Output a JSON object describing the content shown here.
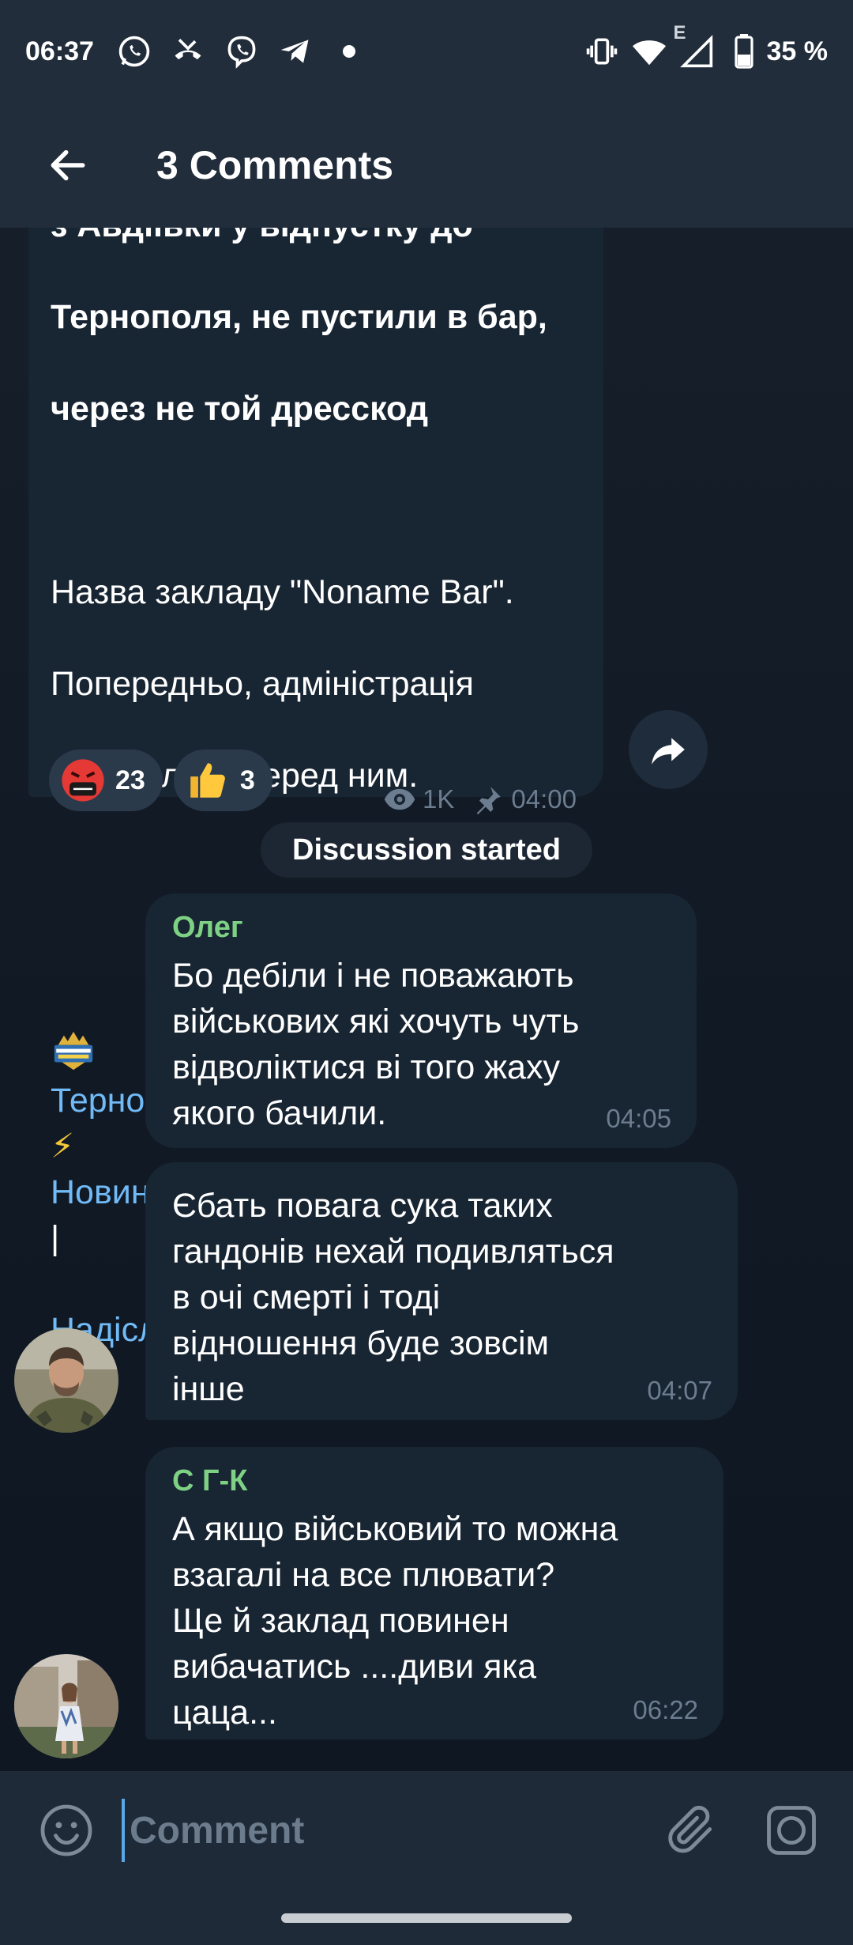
{
  "status_bar": {
    "time": "06:37",
    "battery": "35 %",
    "network_label": "E",
    "left_icons": [
      "whatsapp-icon",
      "missed-call-icon",
      "viber-icon",
      "telegram-icon",
      "dot-icon"
    ],
    "right_icons": [
      "vibrate-icon",
      "wifi-icon",
      "signal-icon",
      "battery-icon"
    ]
  },
  "header": {
    "title": "3 Comments",
    "back_icon": "arrow-left-icon"
  },
  "post": {
    "lines_bold": [
      "з Авдіївки у відпустку до",
      "Тернополя, не пустили в бар,",
      "через не той дресскод"
    ],
    "lines_body": [
      "Назва закладу \"Noname Bar\".",
      "Попередньо, адміністрація",
      "вибачилась перед ним."
    ],
    "channel_link": "Тернопіль",
    "bolt_emoji": "⚡",
    "news_link": "Новини",
    "separator": "|",
    "submit_link": "Надіслати новину",
    "reactions": [
      {
        "emoji": "angry-cursing-emoji",
        "count": "23"
      },
      {
        "emoji": "thumbs-up-emoji",
        "count": "3"
      }
    ],
    "views": "1K",
    "time": "04:00"
  },
  "service_message": "Discussion started",
  "comments": [
    {
      "author": "Олег",
      "text": "Бо дебіли і не поважають\nвійськових які хочуть чуть\nвідволіктися ві того жаху\nякого бачили.",
      "time": "04:05"
    },
    {
      "author": "",
      "text": "Єбать повага сука таких\nгандонів нехай подивляться\nв очі смерті і тоді\nвідношення буде зовсім\nінше",
      "time": "04:07"
    },
    {
      "author": "С Г-К",
      "text": "А якщо військовий то можна\nвзагалі на все плювати?\nЩе й заклад повинен\nвибачатись ....диви яка\nцаца...",
      "time": "06:22"
    }
  ],
  "input": {
    "placeholder": "Comment"
  },
  "colors": {
    "background": "#0e1621",
    "header": "#212d3b",
    "bubble": "#182533",
    "link": "#71baf6",
    "author": "#7ed184",
    "meta": "#6b7d8f"
  }
}
